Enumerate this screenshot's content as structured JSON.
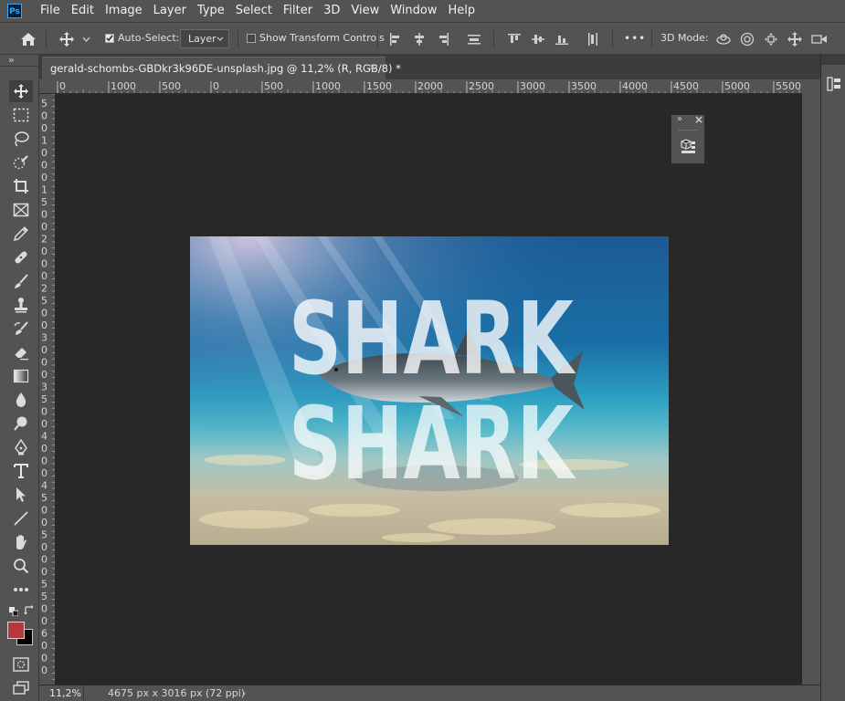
{
  "app": {
    "logo": "Ps"
  },
  "menu": [
    "File",
    "Edit",
    "Image",
    "Layer",
    "Type",
    "Select",
    "Filter",
    "3D",
    "View",
    "Window",
    "Help"
  ],
  "options_bar": {
    "auto_select_label": "Auto-Select:",
    "auto_select_checked": true,
    "target": "Layer",
    "show_transform_label": "Show Transform Controls",
    "show_transform_checked": false,
    "more_label": "•••",
    "mode_3d_label": "3D Mode:"
  },
  "document": {
    "tab_title": "gerald-schombs-GBDkr3k96DE-unsplash.jpg @ 11,2% (R, RGB/8) *",
    "close_glyph": "×"
  },
  "ruler": {
    "h_labels": [
      "0",
      "1000",
      "500",
      "0",
      "500",
      "1000",
      "1500",
      "2000",
      "2500",
      "3000",
      "3500",
      "4000",
      "4500",
      "5000",
      "5500"
    ],
    "v_labels": [
      "5",
      "0",
      "0",
      "1",
      "0",
      "0",
      "0",
      "1",
      "5",
      "0",
      "0",
      "2",
      "0",
      "0",
      "0",
      "2",
      "5",
      "0",
      "0",
      "3",
      "0",
      "0",
      "0",
      "3",
      "5",
      "0",
      "0",
      "4",
      "0",
      "0",
      "0",
      "4",
      "5",
      "0",
      "0",
      "5",
      "0",
      "0",
      "0",
      "5",
      "5",
      "0",
      "0",
      "6",
      "0",
      "0",
      "0"
    ]
  },
  "artwork": {
    "word_top": "SHARK",
    "word_bottom": "SHARK"
  },
  "status": {
    "zoom": "11,2%",
    "doc_size": "4675 px x 3016 px (72 ppi)",
    "arrow": "›"
  },
  "colors": {
    "foreground": "#b5383d",
    "background": "#000000",
    "canvas_bg": "#282828",
    "ui_bg": "#535353"
  },
  "tools_panel": {
    "collapse_glyph": "»"
  },
  "mini_panel": {
    "collapse_glyph": "»",
    "close_glyph": "×"
  }
}
